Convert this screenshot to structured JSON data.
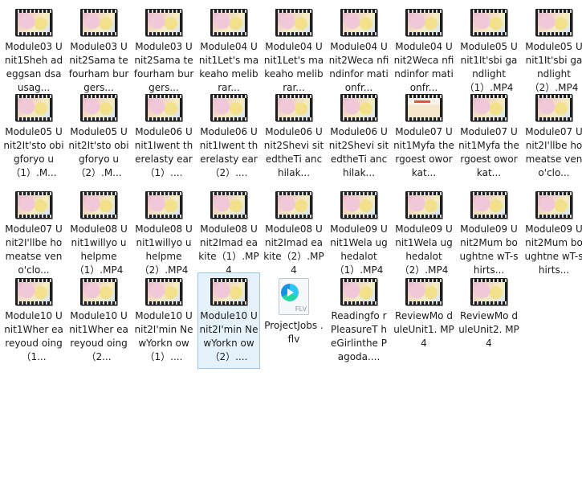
{
  "items": [
    {
      "label": "Module03 Unit1Sheh adeggsan dsausag...",
      "type": "video"
    },
    {
      "label": "Module03 Unit2Sama tefourham burgers...",
      "type": "video"
    },
    {
      "label": "Module03 Unit2Sama tefourham burgers...",
      "type": "video"
    },
    {
      "label": "Module04 Unit1Let's makeaho melibrar...",
      "type": "video"
    },
    {
      "label": "Module04 Unit1Let's makeaho melibrar...",
      "type": "video"
    },
    {
      "label": "Module04 Unit2Weca nfindinfor mationfr...",
      "type": "video"
    },
    {
      "label": "Module04 Unit2Weca nfindinfor mationfr...",
      "type": "video"
    },
    {
      "label": "Module05 Unit1It'sbi gandlight （1）.MP4",
      "type": "video"
    },
    {
      "label": "Module05 Unit1It'sbi gandlight （2）.MP4",
      "type": "video"
    },
    {
      "label": "Module05 Unit2It'sto obigforyo u（1）.M...",
      "type": "video"
    },
    {
      "label": "Module05 Unit2It'sto obigforyo u（2）.M...",
      "type": "video"
    },
    {
      "label": "Module06 Unit1Iwent therelasty ear（1）....",
      "type": "video"
    },
    {
      "label": "Module06 Unit1Iwent therelasty ear（2）....",
      "type": "video"
    },
    {
      "label": "Module06 Unit2Shevi sitedtheTi anchilak...",
      "type": "video"
    },
    {
      "label": "Module06 Unit2Shevi sitedtheTi anchilak...",
      "type": "video"
    },
    {
      "label": "Module07 Unit1Myfa thergoest oworkat...",
      "type": "video-alt"
    },
    {
      "label": "Module07 Unit1Myfa thergoest oworkat...",
      "type": "video"
    },
    {
      "label": "Module07 Unit2I'llbe homeatse veno'clo...",
      "type": "video"
    },
    {
      "label": "Module07 Unit2I'llbe homeatse veno'clo...",
      "type": "video"
    },
    {
      "label": "Module08 Unit1willyo uhelpme（1）.MP4",
      "type": "video"
    },
    {
      "label": "Module08 Unit1willyo uhelpme（2）.MP4",
      "type": "video"
    },
    {
      "label": "Module08 Unit2Imad eakite（1）.MP4",
      "type": "video"
    },
    {
      "label": "Module08 Unit2Imad eakite（2）.MP4",
      "type": "video"
    },
    {
      "label": "Module09 Unit1Wela ughedalot （1）.MP4",
      "type": "video"
    },
    {
      "label": "Module09 Unit1Wela ughedalot （2）.MP4",
      "type": "video"
    },
    {
      "label": "Module09 Unit2Mum boughtne wT-shirts...",
      "type": "video"
    },
    {
      "label": "Module09 Unit2Mum boughtne wT-shirts...",
      "type": "video"
    },
    {
      "label": "Module10 Unit1Wher eareyoud oing（1...",
      "type": "video"
    },
    {
      "label": "Module10 Unit1Wher eareyoud oing（2...",
      "type": "video"
    },
    {
      "label": "Module10 Unit2I'min NewYorkn ow（1）....",
      "type": "video"
    },
    {
      "label": "Module10 Unit2I'min NewYorkn ow（2）....",
      "type": "video",
      "selected": true
    },
    {
      "label": "ProjectJobs .flv",
      "type": "flv",
      "ext": "FLV"
    },
    {
      "label": "Readingfo rPleasureT heGirlinthe Pagoda....",
      "type": "video"
    },
    {
      "label": "ReviewMo duleUnit1. MP4",
      "type": "video"
    },
    {
      "label": "ReviewMo duleUnit2. MP4",
      "type": "video"
    }
  ]
}
